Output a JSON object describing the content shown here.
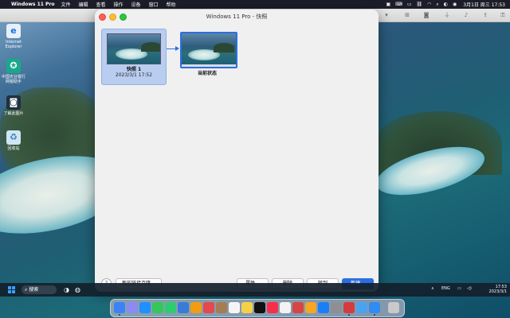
{
  "menubar": {
    "app_name": "Windows 11 Pro",
    "items": [
      "文件",
      "编辑",
      "查看",
      "操作",
      "设备",
      "窗口",
      "帮助"
    ],
    "clock": "3月1日 周三 17:53"
  },
  "desktop_icons": [
    {
      "label": "Internet Explorer",
      "icon": "ie-icon"
    },
    {
      "label": "中国农业银行 网银助手",
      "icon": "abc-bank-icon"
    },
    {
      "label": "了解此图片",
      "icon": "camera-icon"
    },
    {
      "label": "回收站",
      "icon": "recycle-bin-icon"
    }
  ],
  "sheet": {
    "title": "Windows 11 Pro - 快照",
    "snapshot": {
      "name": "快照 1",
      "date": "2023/3/1 17:52"
    },
    "current_state_label": "当前状态",
    "help_label": "?",
    "buttons": {
      "linked_clone": "新的链接克隆...",
      "properties": "属性...",
      "delete": "删除",
      "goto": "转到",
      "new": "新建..."
    }
  },
  "taskbar": {
    "search_label": "搜索",
    "lang": "ENG",
    "time": "17:53",
    "date": "2023/3/1"
  },
  "colors": {
    "accent": "#2b6ee3",
    "selection": "#b9cdf0"
  }
}
